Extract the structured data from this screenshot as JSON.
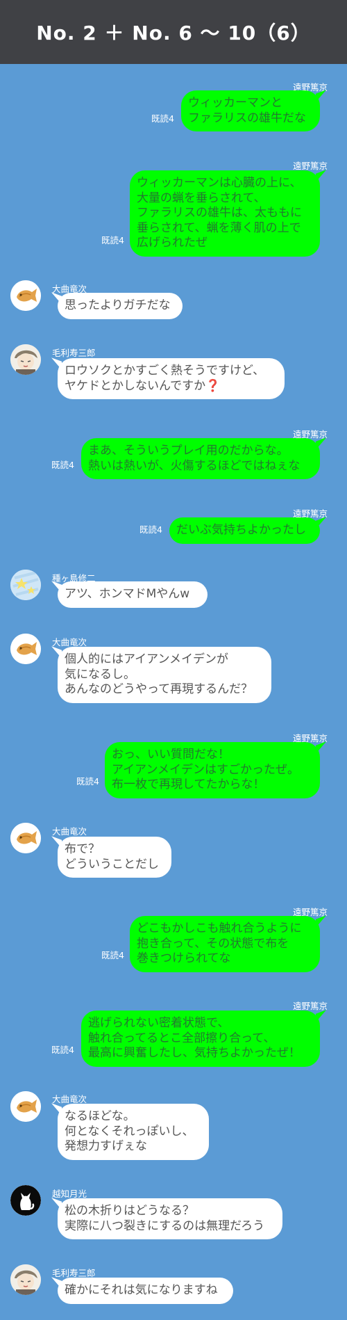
{
  "header": {
    "title": "No. 2 ＋ No. 6 〜 10（6）"
  },
  "messages": [
    {
      "side": "out",
      "sender": "遠野篤京",
      "read": "既読4",
      "text": "ウィッカーマンと\nファラリスの雄牛だな"
    },
    {
      "side": "out",
      "sender": "遠野篤京",
      "read": "既読4",
      "text": "ウィッカーマンは心臓の上に、\n大量の蝋を垂らされて、\nファラリスの雄牛は、太ももに\n垂らされて、蝋を薄く肌の上で\n広げられたぜ"
    },
    {
      "side": "in",
      "sender": "大曲竜次",
      "avatar": "taiyaki-icon",
      "text": "思ったよりガチだな"
    },
    {
      "side": "in",
      "sender": "毛利寿三郎",
      "avatar": "sleepy-character-icon",
      "text": "ロウソクとかすごく熱そうですけど、\nヤケドとかしないんですか❓"
    },
    {
      "side": "out",
      "sender": "遠野篤京",
      "read": "既読4",
      "text": "まあ、そういうプレイ用のだからな。\n熱いは熱いが、火傷するほどではねぇな"
    },
    {
      "side": "out",
      "sender": "遠野篤京",
      "read": "既読4",
      "text": "だいぶ気持ちよかったし"
    },
    {
      "side": "in",
      "sender": "種ヶ島修二",
      "avatar": "stars-icon",
      "text": "アツ、ホンマドMやんw"
    },
    {
      "side": "in",
      "sender": "大曲竜次",
      "avatar": "taiyaki-icon",
      "text": "個人的にはアイアンメイデンが\n気になるし。\nあんなのどうやって再現するんだ？"
    },
    {
      "side": "out",
      "sender": "遠野篤京",
      "read": "既読4",
      "text": "おっ、いい質問だな！\nアイアンメイデンはすごかったぜ。\n布一枚で再現してたからな！"
    },
    {
      "side": "in",
      "sender": "大曲竜次",
      "avatar": "taiyaki-icon",
      "text": "布で？\nどういうことだし"
    },
    {
      "side": "out",
      "sender": "遠野篤京",
      "read": "既読4",
      "text": "どこもかしこも触れ合うように\n抱き合って、その状態で布を\n巻きつけられてな"
    },
    {
      "side": "out",
      "sender": "遠野篤京",
      "read": "既読4",
      "text": "逃げられない密着状態で、\n触れ合ってるとこ全部擦り合って、\n最高に興奮したし、気持ちよかったぜ！"
    },
    {
      "side": "in",
      "sender": "大曲竜次",
      "avatar": "taiyaki-icon",
      "text": "なるほどな。\n何となくそれっぽいし、\n発想力すげぇな"
    },
    {
      "side": "in",
      "sender": "越知月光",
      "avatar": "cat-silhouette-icon",
      "text": "松の木折りはどうなる？\n実際に八つ裂きにするのは無理だろう"
    },
    {
      "side": "in",
      "sender": "毛利寿三郎",
      "avatar": "sleepy-character-icon",
      "text": "確かにそれは気になりますね"
    }
  ]
}
